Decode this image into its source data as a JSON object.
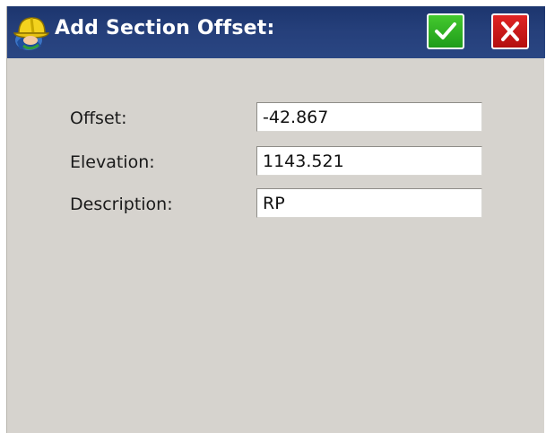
{
  "window": {
    "title": "Add Section Offset:"
  },
  "titlebar": {
    "app_icon": "hardhat-surveyor-icon",
    "ok_icon": "checkmark-icon",
    "cancel_icon": "close-x-icon",
    "colors": {
      "bar": "#253f7a",
      "ok": "#2db223",
      "cancel": "#d11a1a"
    }
  },
  "form": {
    "fields": [
      {
        "label": "Offset:",
        "value": "-42.867"
      },
      {
        "label": "Elevation:",
        "value": "1143.521"
      },
      {
        "label": "Description:",
        "value": "RP"
      }
    ]
  }
}
